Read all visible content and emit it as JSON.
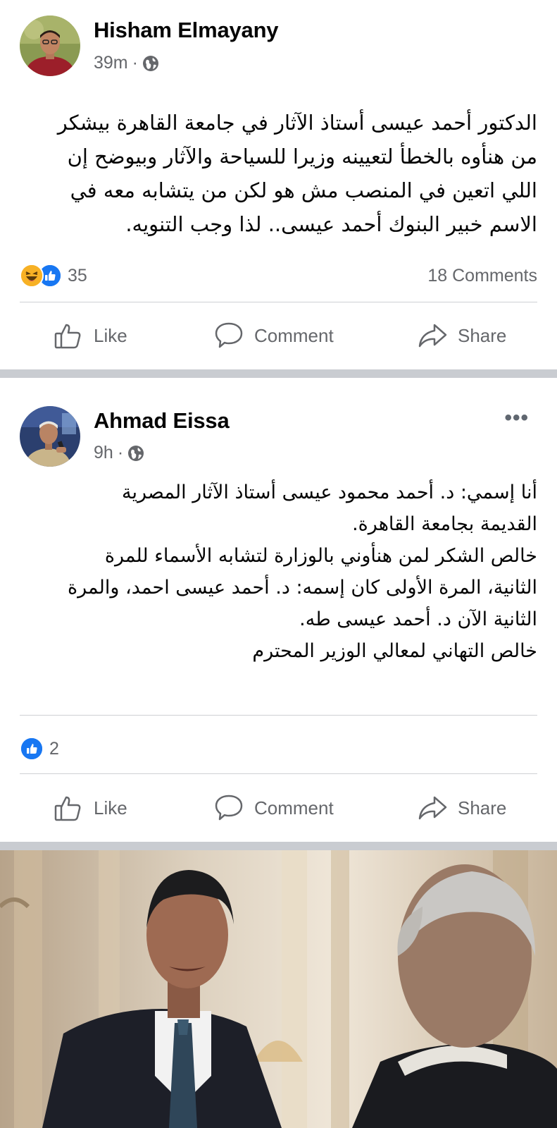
{
  "posts": [
    {
      "author": "Hisham Elmayany",
      "time": "39m",
      "privacy_icon": "globe-icon",
      "body_lines": [
        "الدكتور أحمد عيسى أستاذ الآثار في جامعة القاهرة بيشكر",
        "من هنأوه بالخطأ لتعيينه وزيرا للسياحة والآثار وبيوضح إن",
        "اللي اتعين في المنصب مش هو لكن من يتشابه معه في",
        "الاسم خبير البنوك أحمد عيسى.. لذا وجب التنويه."
      ],
      "reactions": {
        "icons": [
          "haha-icon",
          "like-icon"
        ],
        "count": "35"
      },
      "comments": "18 Comments",
      "actions": {
        "like": "Like",
        "comment": "Comment",
        "share": "Share"
      }
    },
    {
      "author": "Ahmad Eissa",
      "time": "9h",
      "privacy_icon": "globe-icon",
      "more": "•••",
      "body_lines": [
        "أنا إسمي: د. أحمد محمود عيسى أستاذ الآثار المصرية",
        "القديمة بجامعة القاهرة.",
        "خالص الشكر لمن هنأوني بالوزارة لتشابه الأسماء للمرة",
        "الثانية، المرة الأولى كان إسمه: د. أحمد عيسى احمد، والمرة",
        "الثانية الآن د. أحمد عيسى طه.",
        "خالص التهاني لمعالي الوزير المحترم"
      ],
      "reactions": {
        "icons": [
          "like-icon"
        ],
        "count": "2"
      },
      "actions": {
        "like": "Like",
        "comment": "Comment",
        "share": "Share"
      }
    }
  ],
  "colors": {
    "like_blue": "#1877f2",
    "haha_yellow": "#f7b125",
    "secondary_text": "#65676b",
    "separator": "#c9ccd1"
  }
}
